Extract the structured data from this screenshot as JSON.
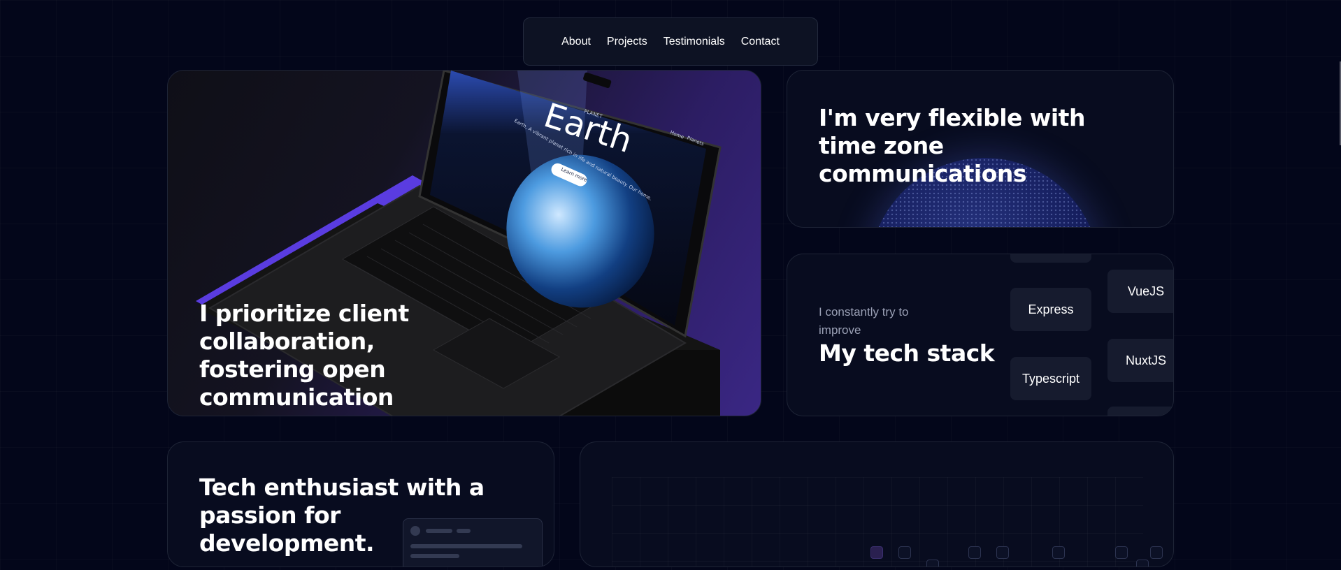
{
  "nav": {
    "items": [
      {
        "label": "About"
      },
      {
        "label": "Projects"
      },
      {
        "label": "Testimonials"
      },
      {
        "label": "Contact"
      }
    ]
  },
  "hero": {
    "title": "I prioritize client collaboration, fostering open communication",
    "screen": {
      "overline": "PLANET",
      "headline": "Earth",
      "tagline": "Earth, A vibrant planet rich in life and natural beauty. Our home.",
      "cta": "Learn more",
      "nav_home": "Home",
      "nav_planets": "Planets"
    }
  },
  "timezone": {
    "title": "I'm very flexible with time zone communications"
  },
  "stack": {
    "subtitle": "I constantly try to improve",
    "title": "My tech stack",
    "pills": [
      {
        "label": "Express"
      },
      {
        "label": "VueJS"
      },
      {
        "label": "Typescript"
      },
      {
        "label": "NuxtJS"
      }
    ]
  },
  "enthusiast": {
    "title": "Tech enthusiast with a passion for development."
  },
  "colors": {
    "background": "#03061a",
    "card": "#080c1f",
    "accent_purple": "#5b3ef0"
  }
}
